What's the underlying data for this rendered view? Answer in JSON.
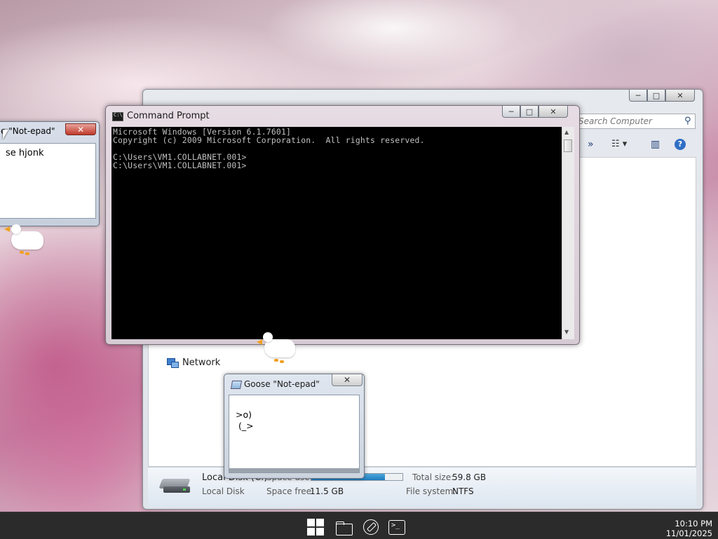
{
  "explorer": {
    "search_placeholder": "Search Computer",
    "buttons": {
      "minimize": "─",
      "maximize": "□",
      "close": "✕"
    },
    "toolbar": {
      "more": "»",
      "views": "☷ ▾",
      "preview": "▥",
      "help": "?"
    },
    "nav": {
      "network": "Network"
    },
    "details": {
      "drive_name": "Local Disk (C:)",
      "drive_type": "Local Disk",
      "space_used_label": "Space used:",
      "space_free_label": "Space free:",
      "space_free_value": "11.5 GB",
      "total_size_label": "Total size:",
      "total_size_value": "59.8 GB",
      "file_system_label": "File system:",
      "file_system_value": "NTFS",
      "used_fraction": 0.81
    }
  },
  "left_notepad": {
    "title": "e \"Not-epad\"",
    "close": "✕",
    "text": "se hjonk"
  },
  "cmd": {
    "title": "Command Prompt",
    "buttons": {
      "minimize": "─",
      "maximize": "□",
      "close": "✕"
    },
    "output": "Microsoft Windows [Version 6.1.7601]\nCopyright (c) 2009 Microsoft Corporation.  All rights reserved.\n\nC:\\Users\\VM1.COLLABNET.001>\nC:\\Users\\VM1.COLLABNET.001>",
    "scroll_up": "▲",
    "scroll_down": "▼"
  },
  "goose_notepad": {
    "title": "Goose \"Not-epad\"",
    "close": "✕",
    "art": ">o)\n (_>"
  },
  "taskbar": {
    "terminal_prompt": ">_",
    "time": "10:10 PM",
    "date": "11/01/2025"
  },
  "colors": {
    "taskbar": "#2b2b2b",
    "console_bg": "#000000",
    "console_fg": "#c0c0c0",
    "goose_beak": "#f0a020",
    "usage_fill": "#1e7cc0"
  }
}
